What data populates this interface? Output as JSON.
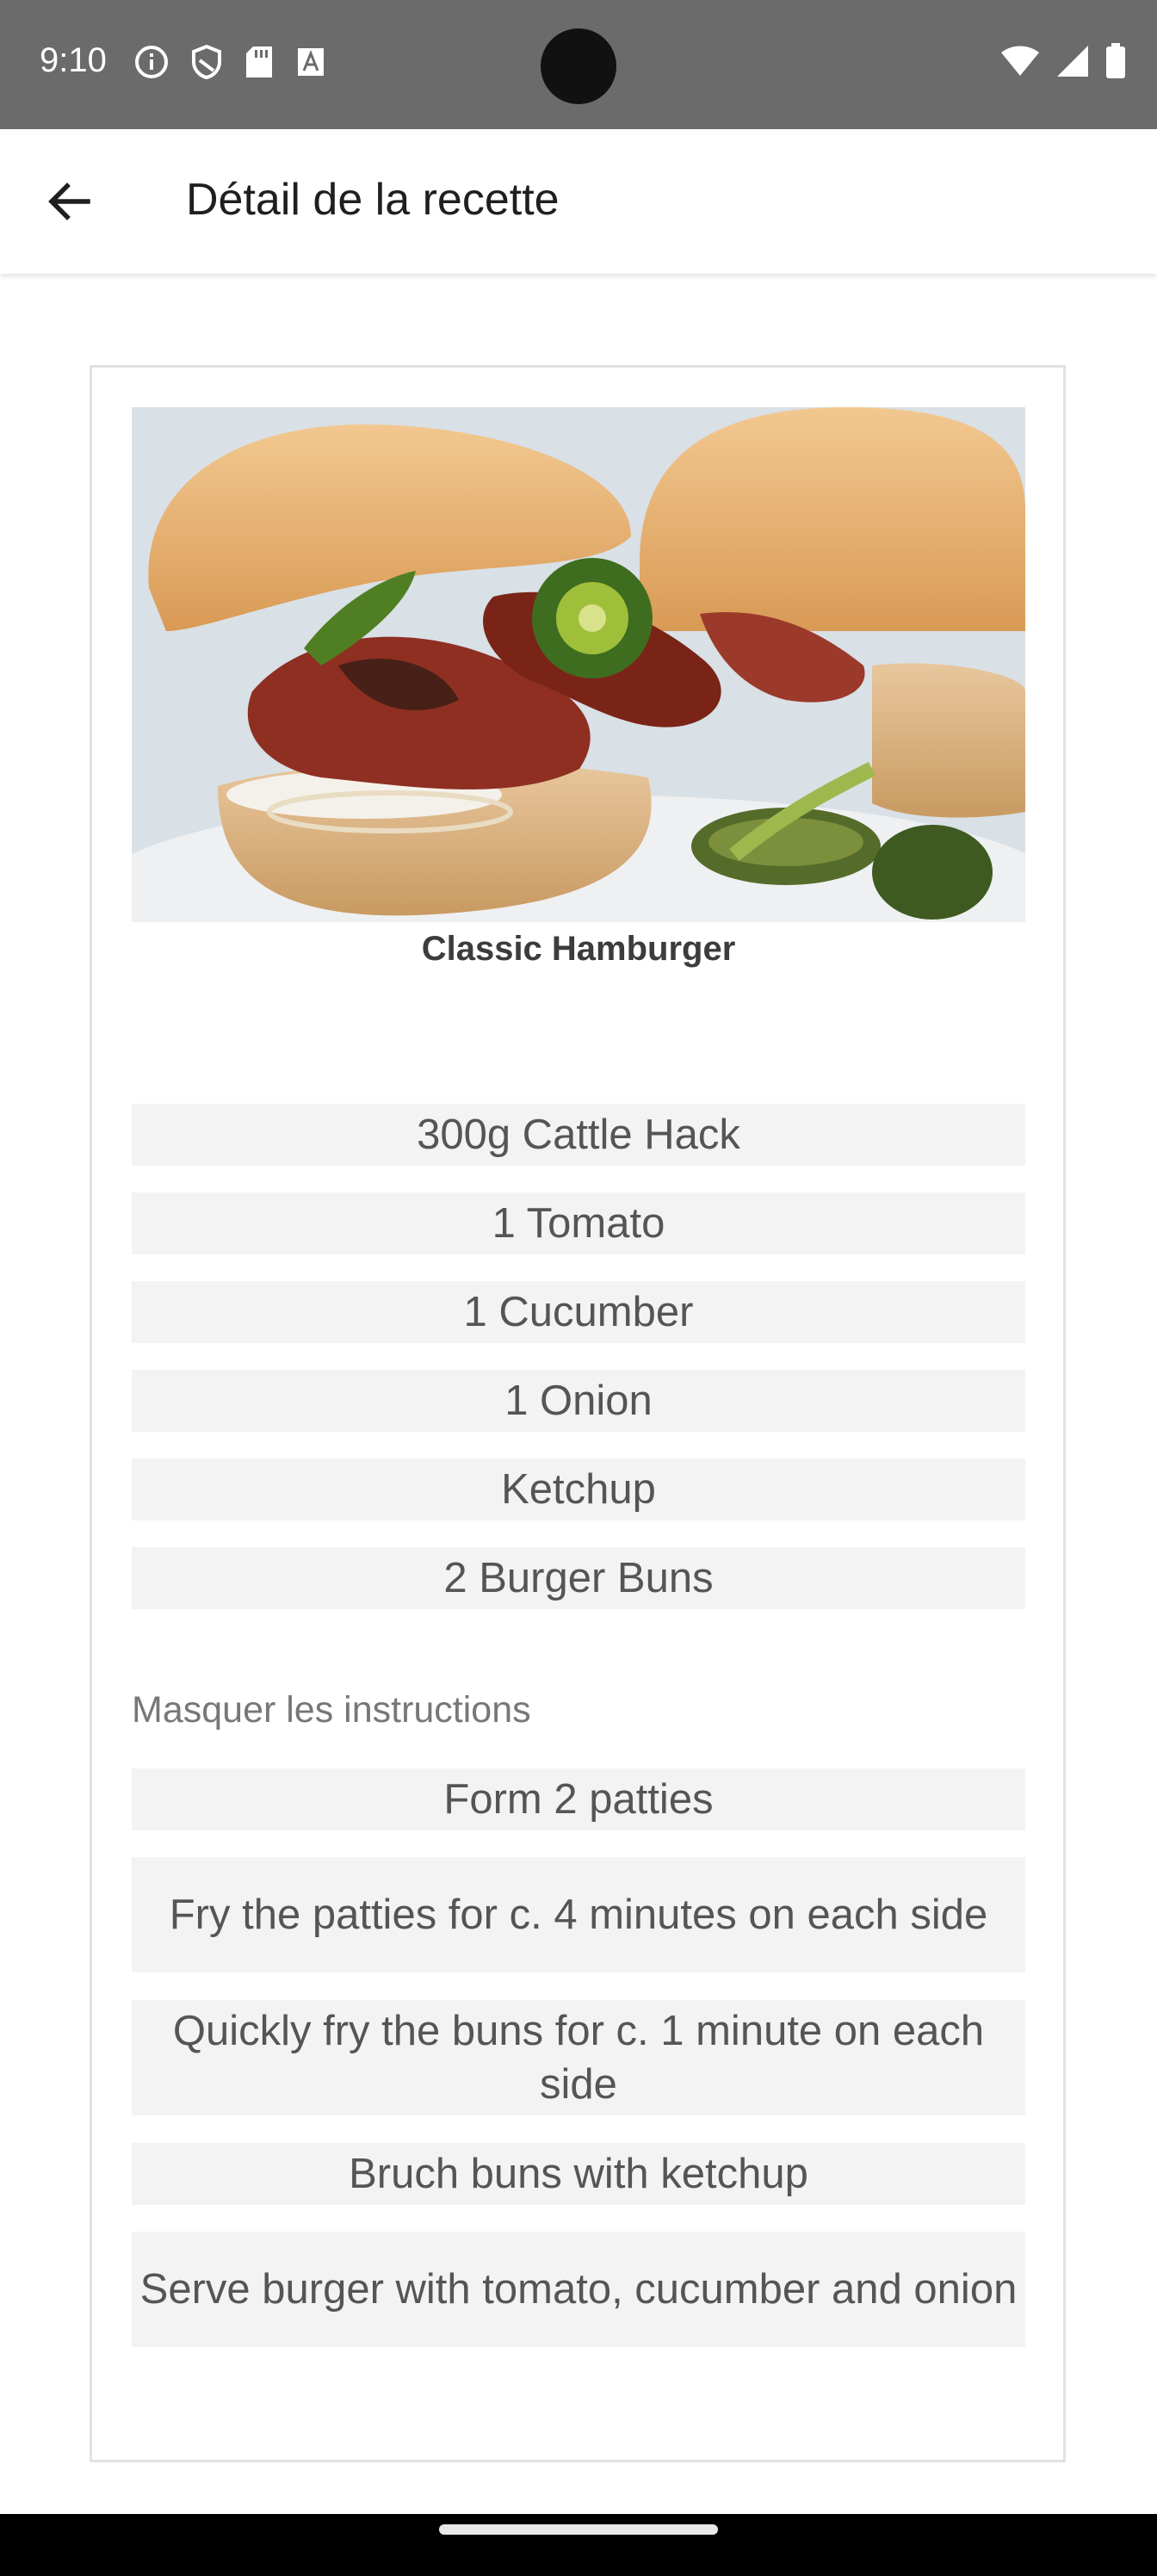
{
  "status_bar": {
    "time": "9:10",
    "left_icons": [
      "info-icon",
      "shield-icon",
      "sd-card-icon",
      "font-icon"
    ],
    "right_icons": [
      "wifi-icon",
      "signal-icon",
      "battery-icon"
    ]
  },
  "app_bar": {
    "title": "Détail de la recette",
    "back_icon": "arrow-back-icon"
  },
  "recipe": {
    "name": "Classic Hamburger",
    "image": "hamburger-photo",
    "ingredients": [
      "300g Cattle Hack",
      "1 Tomato",
      "1 Cucumber",
      "1 Onion",
      "Ketchup",
      "2 Burger Buns"
    ],
    "toggle_label": "Masquer les instructions",
    "instructions": [
      "Form 2 patties",
      "Fry the patties for c. 4 minutes on each side",
      "Quickly fry the buns for c. 1 minute on each side",
      "Bruch buns with ketchup",
      "Serve burger with tomato, cucumber and onion"
    ]
  },
  "colors": {
    "status_bar": "#6b6b6b",
    "row_background": "#f3f3f3",
    "card_border": "#e2e2e2"
  }
}
